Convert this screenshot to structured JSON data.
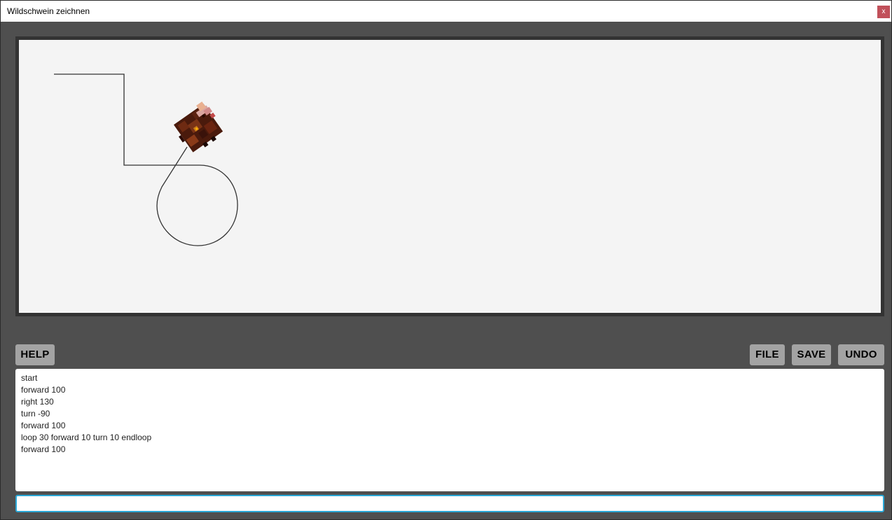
{
  "window": {
    "title": "Wildschwein zeichnen",
    "close_label": "x"
  },
  "toolbar": {
    "help_label": "HELP",
    "file_label": "FILE",
    "save_label": "SAVE",
    "undo_label": "UNDO"
  },
  "editor": {
    "lines": [
      "start",
      "forward 100",
      "right 130",
      "turn -90",
      "forward 100",
      "loop 30 forward 10 turn 10 endloop",
      "forward 100"
    ]
  },
  "command_input": {
    "value": "",
    "placeholder": ""
  },
  "colors": {
    "background": "#4f4f4f",
    "canvas": "#f4f4f4",
    "button": "#a3a3a3",
    "focus_border": "#2aa7d6",
    "close": "#c1505a"
  }
}
